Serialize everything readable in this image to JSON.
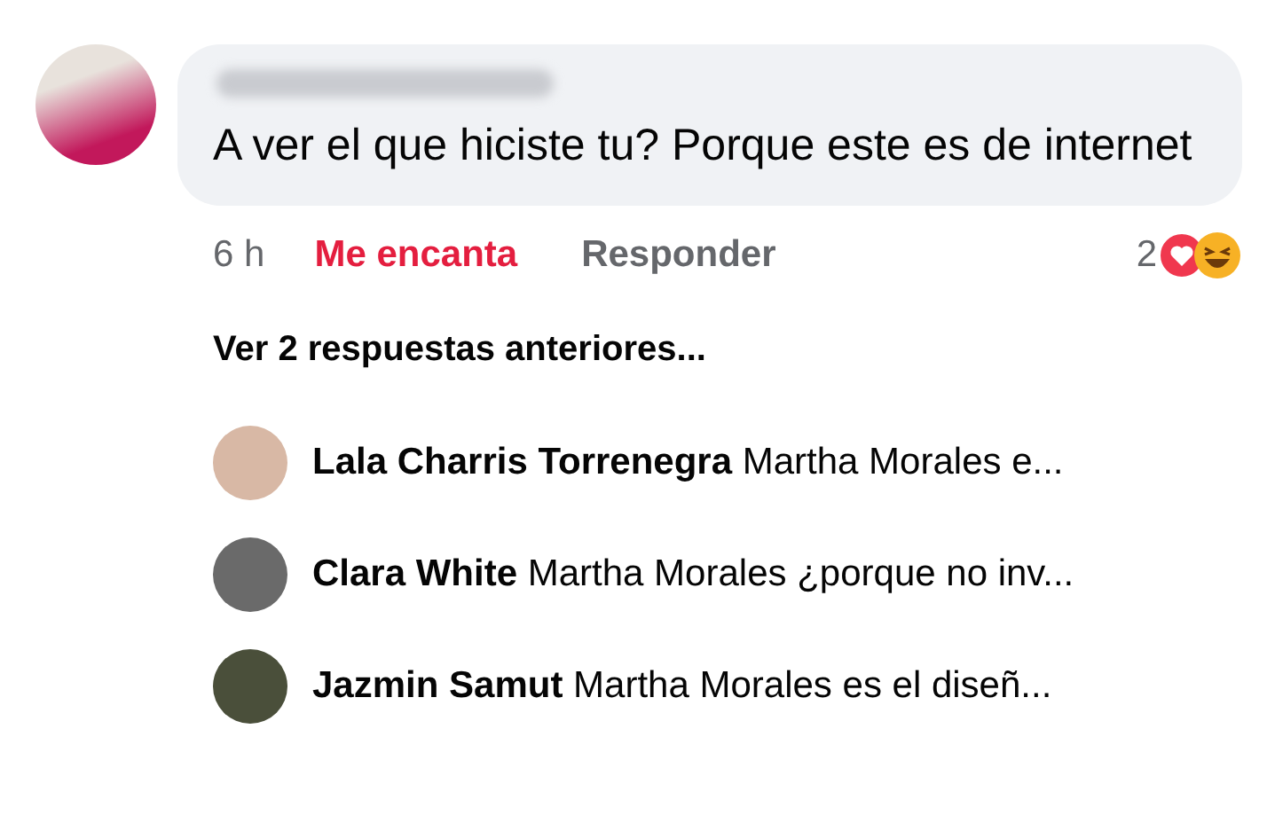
{
  "comment": {
    "text": "A ver el que hiciste tu? Porque este es de internet",
    "time": "6 h",
    "actions": [
      {
        "label": "Me encanta",
        "kind": "react",
        "reacted": true
      },
      {
        "label": "Responder",
        "kind": "reply"
      }
    ],
    "reaction_count": "2"
  },
  "more_replies": "Ver 2 respuestas anteriores...",
  "replies": [
    {
      "author": "Lala Charris Torrenegra",
      "text": "Martha Morales e..."
    },
    {
      "author": "Clara White",
      "text": "Martha Morales ¿porque no inv..."
    },
    {
      "author": "Jazmin Samut",
      "text": "Martha Morales es el diseñ..."
    }
  ]
}
